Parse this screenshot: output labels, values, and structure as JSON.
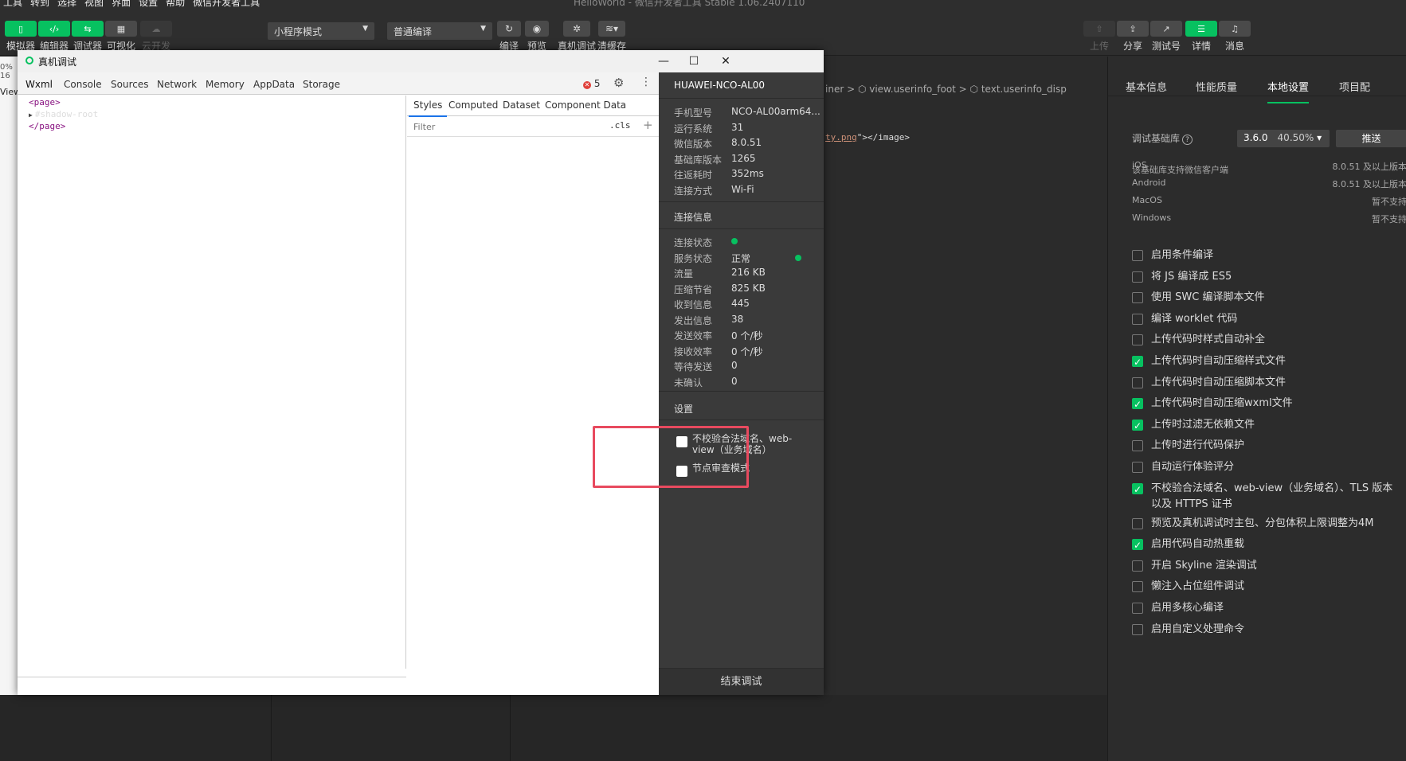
{
  "menubar": {
    "items": [
      "工具",
      "转到",
      "选择",
      "视图",
      "界面",
      "设置",
      "帮助",
      "微信开发者工具"
    ],
    "window_title": "HelloWorld - 微信开发者工具 Stable 1.06.2407110"
  },
  "toolbar": {
    "simulator": "模拟器",
    "editor": "编辑器",
    "debugger": "调试器",
    "visual": "可视化",
    "cloud": "云开发",
    "mode_select": "小程序模式",
    "compile_select": "普通编译",
    "compile": "编译",
    "preview": "预览",
    "real_debug": "真机调试",
    "clear_cache": "清缓存",
    "upload": "上传",
    "share": "分享",
    "test_account": "测试号",
    "details": "详情",
    "messages": "消息"
  },
  "background": {
    "pct": "0% 16",
    "view": "View",
    "breadcrumb": "iner  >  ⬡ view.userinfo_foot  >  ⬡ text.userinfo_disp",
    "code_src": "ty.png",
    "code_rest": "\"></image>"
  },
  "debug_window": {
    "title": "真机调试",
    "tabs": [
      "Wxml",
      "Console",
      "Sources",
      "Network",
      "Memory",
      "AppData",
      "Storage"
    ],
    "error_count": "5",
    "dom": {
      "page_open": "<page>",
      "shadow_root": "#shadow-root",
      "page_close": "</page>"
    },
    "style_tabs": [
      "Styles",
      "Computed",
      "Dataset",
      "Component Data"
    ],
    "filter_placeholder": "Filter",
    "cls": ".cls",
    "plus": "+",
    "device": {
      "name": "HUAWEI-NCO-AL00",
      "rows": [
        {
          "label": "手机型号",
          "value": "NCO-AL00arm64..."
        },
        {
          "label": "运行系统",
          "value": "31"
        },
        {
          "label": "微信版本",
          "value": "8.0.51"
        },
        {
          "label": "基础库版本",
          "value": "1265"
        },
        {
          "label": "往返耗时",
          "value": "352ms"
        },
        {
          "label": "连接方式",
          "value": "Wi-Fi"
        }
      ]
    },
    "connection": {
      "title": "连接信息",
      "status_label": "连接状态",
      "service_label": "服务状态",
      "service_value": "正常",
      "rows": [
        {
          "label": "流量",
          "value": "216 KB"
        },
        {
          "label": "压缩节省",
          "value": "825 KB"
        },
        {
          "label": "收到信息",
          "value": "445"
        },
        {
          "label": "发出信息",
          "value": "38"
        },
        {
          "label": "发送效率",
          "value": "0 个/秒"
        },
        {
          "label": "接收效率",
          "value": "0 个/秒"
        },
        {
          "label": "等待发送",
          "value": "0"
        },
        {
          "label": "未确认",
          "value": "0"
        }
      ]
    },
    "settings": {
      "title": "设置",
      "no_verify_line1": "不校验合法域名、web-",
      "no_verify_line2": "view（业务域名）",
      "node_review": "节点审查模式"
    },
    "end_debug": "结束调试"
  },
  "right_panel": {
    "tabs": [
      "基本信息",
      "性能质量",
      "本地设置",
      "项目配"
    ],
    "active_tab": "本地设置",
    "lib_label": "调试基础库",
    "lib_version": "3.6.0",
    "lib_pct": "40.50%",
    "push": "推送",
    "support_title": "该基础库支持微信客户端",
    "support": [
      {
        "os": "iOS",
        "value": "8.0.51 及以上版本"
      },
      {
        "os": "Android",
        "value": "8.0.51 及以上版本"
      },
      {
        "os": "MacOS",
        "value": "暂不支持"
      },
      {
        "os": "Windows",
        "value": "暂不支持"
      }
    ],
    "options": [
      {
        "label": "启用条件编译",
        "checked": false
      },
      {
        "label": "将 JS 编译成 ES5",
        "checked": false
      },
      {
        "label": "使用 SWC 编译脚本文件",
        "checked": false
      },
      {
        "label": "编译 worklet 代码",
        "checked": false
      },
      {
        "label": "上传代码时样式自动补全",
        "checked": false
      },
      {
        "label": "上传代码时自动压缩样式文件",
        "checked": true
      },
      {
        "label": "上传代码时自动压缩脚本文件",
        "checked": false
      },
      {
        "label": "上传代码时自动压缩wxml文件",
        "checked": true
      },
      {
        "label": "上传时过滤无依赖文件",
        "checked": true
      },
      {
        "label": "上传时进行代码保护",
        "checked": false
      },
      {
        "label": "自动运行体验评分",
        "checked": false
      },
      {
        "label": "不校验合法域名、web-view（业务域名）、TLS 版本以及 HTTPS 证书",
        "checked": true
      },
      {
        "label": "预览及真机调试时主包、分包体积上限调整为4M",
        "checked": false
      },
      {
        "label": "启用代码自动热重载",
        "checked": true
      },
      {
        "label": "开启 Skyline 渲染调试",
        "checked": false
      },
      {
        "label": "懒注入占位组件调试",
        "checked": false
      },
      {
        "label": "启用多核心编译",
        "checked": false
      },
      {
        "label": "启用自定义处理命令",
        "checked": false
      }
    ]
  },
  "colors": {
    "accent": "#07c160",
    "annotation_arrow": "#1296f0",
    "annotation_box": "#e84a5f"
  }
}
